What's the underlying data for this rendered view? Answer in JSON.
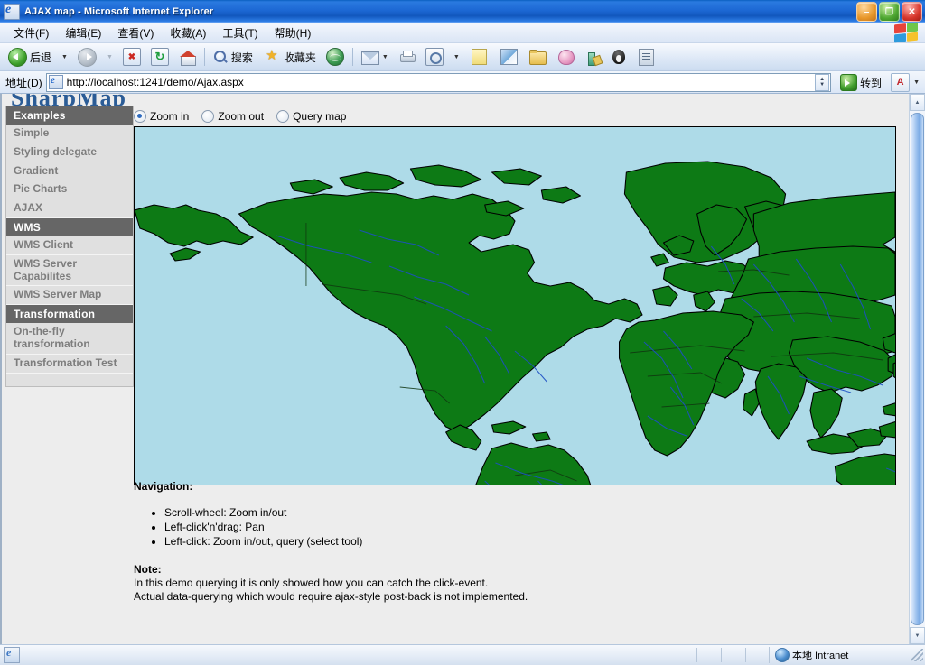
{
  "window": {
    "title": "AJAX map - Microsoft Internet Explorer",
    "icon": "ie-document-icon",
    "minimize_label": "–",
    "restore_label": "❐",
    "close_label": "✕"
  },
  "menu": {
    "items": [
      {
        "label": "文件(F)",
        "name": "menu-file"
      },
      {
        "label": "编辑(E)",
        "name": "menu-edit"
      },
      {
        "label": "查看(V)",
        "name": "menu-view"
      },
      {
        "label": "收藏(A)",
        "name": "menu-favorites"
      },
      {
        "label": "工具(T)",
        "name": "menu-tools"
      },
      {
        "label": "帮助(H)",
        "name": "menu-help"
      }
    ]
  },
  "toolbar": {
    "back_label": "后退",
    "search_label": "搜索",
    "favorites_label": "收藏夹",
    "caret": "▼",
    "icons": [
      "back-arrow-icon",
      "forward-arrow-icon",
      "stop-icon",
      "refresh-icon",
      "home-icon",
      "search-icon",
      "favorites-star-icon",
      "media-globe-icon",
      "mail-icon",
      "print-icon",
      "history-icon",
      "notes-icon",
      "messenger-icon",
      "download-folder-icon",
      "piggy-icon",
      "translate-icon",
      "qq-penguin-icon",
      "document-icon"
    ]
  },
  "address": {
    "label": "地址(D)",
    "url": "http://localhost:1241/demo/Ajax.aspx",
    "go_label": "转到",
    "dropdown_caret": "▼",
    "spin_up": "▲",
    "spin_down": "▼"
  },
  "page": {
    "cut_heading": "SharpMap",
    "sidebar": [
      {
        "label": "Examples",
        "type": "header",
        "name": "sidebar-header-examples"
      },
      {
        "label": "Simple",
        "type": "item",
        "name": "sidebar-item-simple"
      },
      {
        "label": "Styling delegate",
        "type": "item",
        "name": "sidebar-item-styling-delegate"
      },
      {
        "label": "Gradient",
        "type": "item",
        "name": "sidebar-item-gradient"
      },
      {
        "label": "Pie Charts",
        "type": "item",
        "name": "sidebar-item-pie-charts"
      },
      {
        "label": "AJAX",
        "type": "item",
        "name": "sidebar-item-ajax"
      },
      {
        "label": "WMS",
        "type": "header",
        "name": "sidebar-header-wms"
      },
      {
        "label": "WMS Client",
        "type": "item",
        "name": "sidebar-item-wms-client"
      },
      {
        "label": "WMS Server Capabilites",
        "type": "item",
        "name": "sidebar-item-wms-server-capabilites"
      },
      {
        "label": "WMS Server Map",
        "type": "item",
        "name": "sidebar-item-wms-server-map"
      },
      {
        "label": "Transformation",
        "type": "header",
        "name": "sidebar-header-transformation"
      },
      {
        "label": "On-the-fly transformation",
        "type": "item",
        "name": "sidebar-item-on-the-fly-transformation"
      },
      {
        "label": "Transformation Test",
        "type": "item",
        "name": "sidebar-item-transformation-test"
      }
    ],
    "tools": [
      {
        "label": "Zoom in",
        "selected": true,
        "name": "radio-zoom-in"
      },
      {
        "label": "Zoom out",
        "selected": false,
        "name": "radio-zoom-out"
      },
      {
        "label": "Query map",
        "selected": false,
        "name": "radio-query-map"
      }
    ],
    "map": {
      "ocean_color": "#aedbe8",
      "land_color": "#0d7a15",
      "border_color": "#000000",
      "river_color": "#1d4fc4",
      "outline_color": "#000000"
    },
    "navigation_heading": "Navigation:",
    "navigation_items": [
      "Scroll-wheel: Zoom in/out",
      "Left-click'n'drag: Pan",
      "Left-click: Zoom in/out, query (select tool)"
    ],
    "note_heading": "Note:",
    "note_lines": [
      "In this demo querying it is only showed how you can catch the click-event.",
      "Actual data-querying which would require ajax-style post-back is not implemented."
    ]
  },
  "scrollbar": {
    "up": "▲",
    "down": "▼"
  },
  "statusbar": {
    "zone": "本地 Intranet",
    "zone_icon": "intranet-globe-icon"
  }
}
